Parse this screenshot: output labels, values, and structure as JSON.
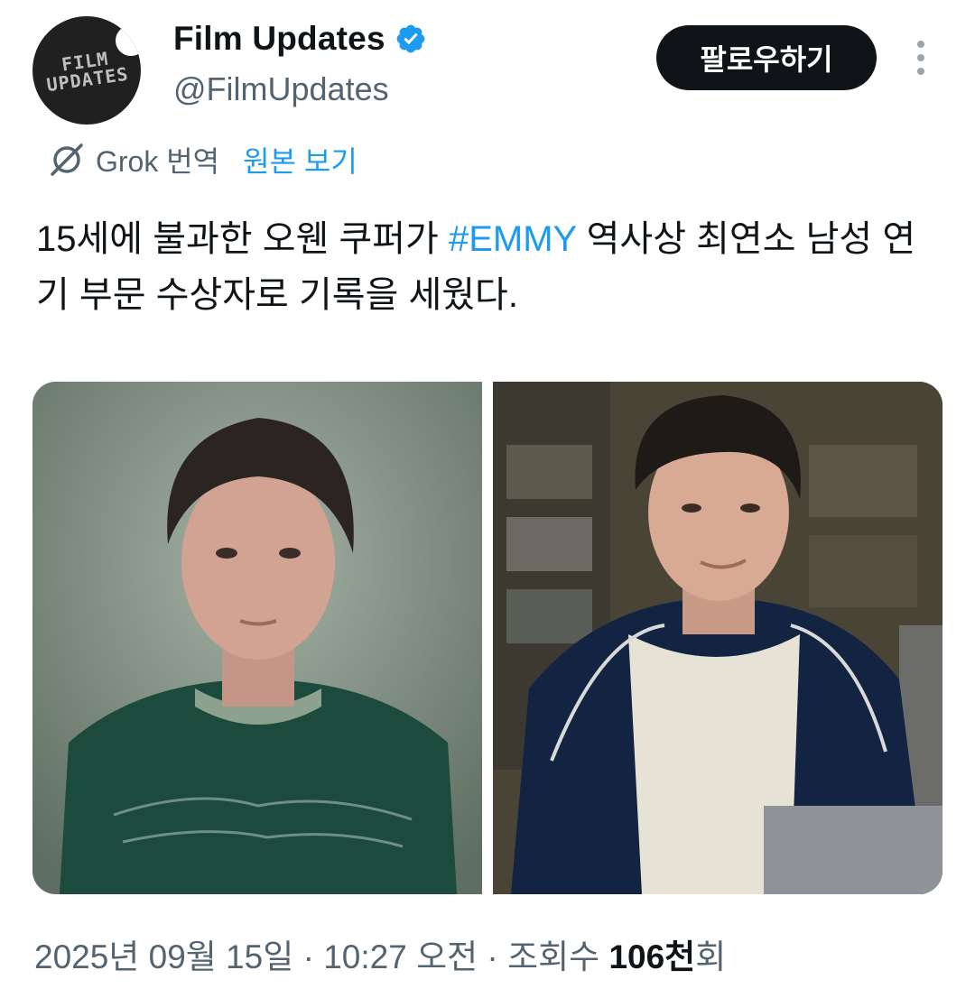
{
  "author": {
    "display_name": "Film Updates",
    "handle": "@FilmUpdates",
    "avatar_text_line1": "FILM",
    "avatar_text_line2": "UPDATES"
  },
  "follow_button": {
    "label": "팔로우하기"
  },
  "translation": {
    "label": "Grok 번역",
    "show_original": "원본 보기"
  },
  "tweet": {
    "text_before": " 15세에 불과한 오웬 쿠퍼가 ",
    "hashtag": "#EMMY",
    "text_after": " 역사상 최연소 남성 연기 부문 수상자로 기록을 세웠다."
  },
  "media": [
    {
      "icon": "photo-teen-green-shirt"
    },
    {
      "icon": "photo-teen-tracksuit-jacket"
    }
  ],
  "meta": {
    "date": "2025년 09월 15일",
    "separator1": " · ",
    "time": "10:27 오전",
    "separator2": " · ",
    "views_label": "조회수 ",
    "views_count": "106천",
    "views_suffix": "회"
  },
  "colors": {
    "link": "#1d9bf0",
    "text": "#0f1419",
    "secondary": "#536471",
    "verified": "#1d9bf0"
  }
}
